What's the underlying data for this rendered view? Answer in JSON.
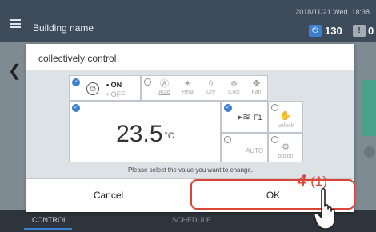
{
  "header": {
    "building_name": "Building name",
    "datetime": "2018/11/21 Wed. 18:38",
    "power_units": "130",
    "warning_units": "0",
    "menu_icon": "hamburger-icon",
    "power_icon": "power-icon",
    "warning_icon": "warning-icon"
  },
  "nav": {
    "control": "CONTROL",
    "schedule": "SCHEDULE"
  },
  "dialog": {
    "title": "collectively control",
    "power": {
      "on": "• ON",
      "off": "• OFF",
      "selected": "ON"
    },
    "modes": [
      {
        "label": "Auto",
        "icon": "auto-mode-icon"
      },
      {
        "label": "Heat",
        "icon": "heat-sun-icon"
      },
      {
        "label": "Dry",
        "icon": "dry-drop-icon"
      },
      {
        "label": "Cool",
        "icon": "cool-snowflake-icon"
      },
      {
        "label": "Fan",
        "icon": "fan-icon"
      }
    ],
    "temperature": "23.5",
    "temperature_unit": "°C",
    "fan_speed": "F1",
    "unlock_label": "unlock",
    "auto_label": "AUTO",
    "option_label": "option",
    "hint": "Please select the value you want to change.",
    "cancel": "Cancel",
    "ok": "OK"
  },
  "annotation": {
    "step_number": "4",
    "step_sub": "-(1)",
    "highlight_color": "#d8463b"
  },
  "colors": {
    "accent": "#3a7fd0",
    "topbar": "#3e4b5b"
  }
}
